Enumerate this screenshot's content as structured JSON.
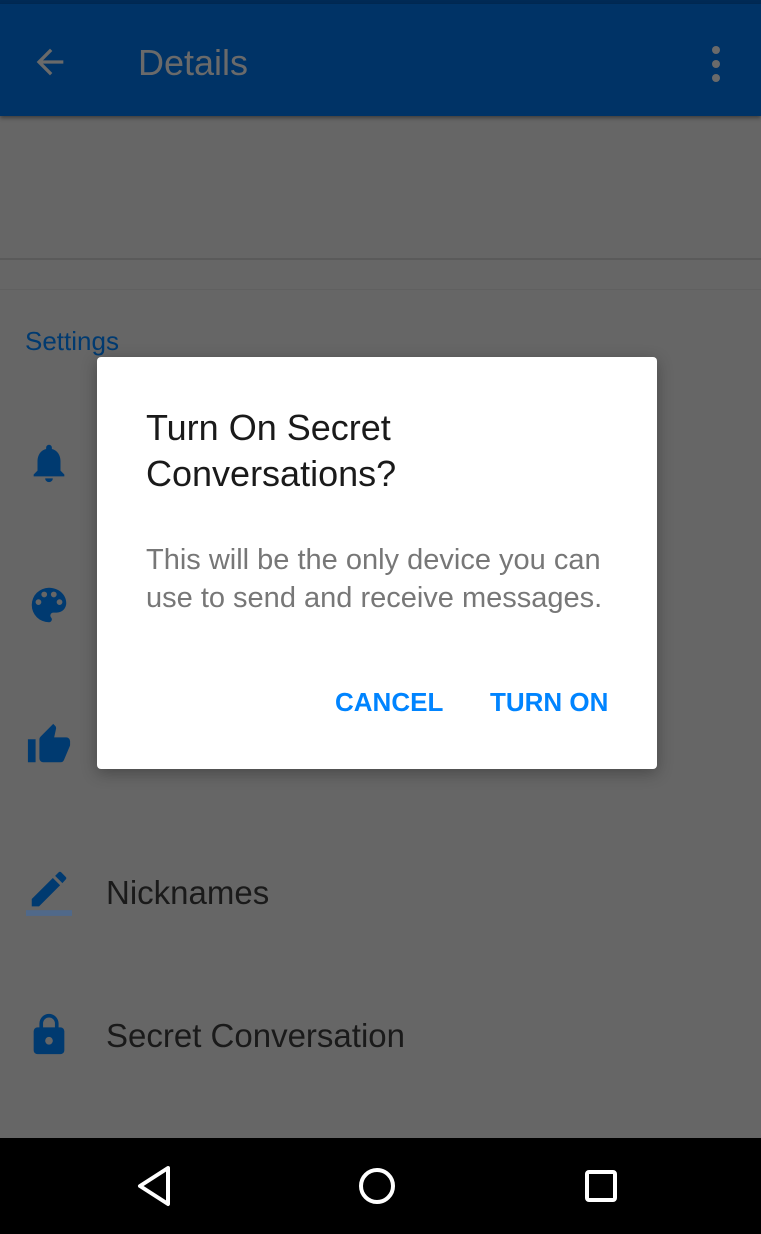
{
  "app_bar": {
    "title": "Details",
    "back_icon": "arrow-left-icon",
    "menu_icon": "more-vert-icon",
    "color": "#003366"
  },
  "settings": {
    "section_title": "Settings",
    "items": [
      {
        "icon": "bell-icon",
        "label": ""
      },
      {
        "icon": "palette-icon",
        "label": ""
      },
      {
        "icon": "thumbs-up-icon",
        "label": ""
      },
      {
        "icon": "pencil-icon",
        "label": "Nicknames"
      },
      {
        "icon": "lock-icon",
        "label": "Secret Conversation"
      }
    ]
  },
  "dialog": {
    "title": "Turn On Secret Conversations?",
    "message": "This will be the only device you can use to send and receive messages.",
    "cancel_label": "CANCEL",
    "confirm_label": "TURN ON",
    "accent": "#0084ff"
  },
  "nav_bar": {
    "back_icon": "triangle-back-icon",
    "home_icon": "circle-home-icon",
    "recents_icon": "square-recents-icon"
  }
}
